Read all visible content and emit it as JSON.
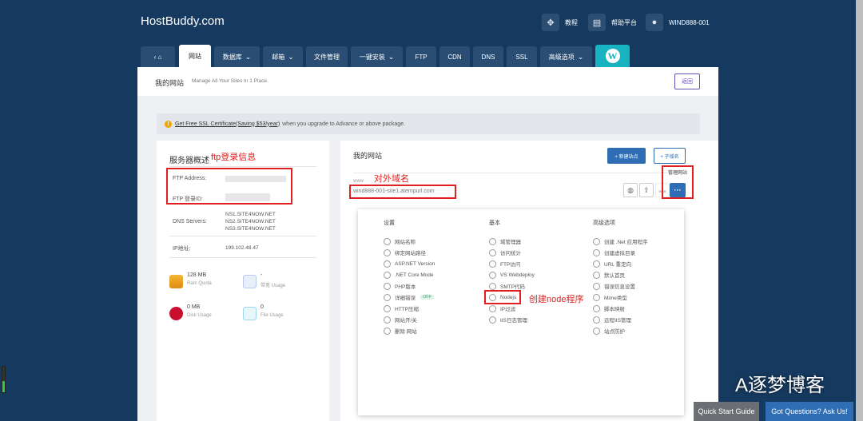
{
  "header": {
    "brand": "HostBuddy.com",
    "tutorial": "教程",
    "help": "帮助平台",
    "user": "WIND888-001"
  },
  "tabs": [
    {
      "label": "网站"
    },
    {
      "label": "数据库"
    },
    {
      "label": "邮箱"
    },
    {
      "label": "文件管理"
    },
    {
      "label": "一键安装"
    },
    {
      "label": "FTP"
    },
    {
      "label": "CDN"
    },
    {
      "label": "DNS"
    },
    {
      "label": "SSL"
    },
    {
      "label": "高级选项"
    }
  ],
  "page": {
    "title": "我的网站",
    "subtitle": "Manage All Your Sites In 1 Place.",
    "return": "返回"
  },
  "ssl_banner": {
    "link": "Get Free SSL Certificate(Saving $53/year)",
    "text": "when you upgrade to Advance or above package."
  },
  "server": {
    "title": "服务器概述",
    "ftp_address_label": "FTP Address:",
    "ftp_login_label": "FTP 登录ID:",
    "dns_label": "DNS Servers:",
    "dns": [
      "NS1.SITE4NOW.NET",
      "NS2.SITE4NOW.NET",
      "NS3.SITE4NOW.NET"
    ],
    "ip_label": "IP地址:",
    "ip": "199.102.48.47",
    "ram_value": "128 MB",
    "ram_label": "Ram Quota",
    "bw_value": "-",
    "bw_label": "带宽 Usage",
    "disk_value": "0 MB",
    "disk_label": "Disk Usage",
    "file_value": "0",
    "file_label": "File Usage"
  },
  "sites": {
    "title": "我的网站",
    "new_site": "+ 新建站点",
    "sub_domain": "+ 子域名",
    "manage": "管理网站",
    "www": "www",
    "domain": "wind888-001-site1.atempurl.com",
    "more": "···"
  },
  "menu": {
    "col1_head": "设置",
    "col1": [
      "网站名称",
      "绑定网站路径",
      "ASP.NET Version",
      ".NET Core Mode",
      "PHP版本",
      "详细错误",
      "HTTP压缩",
      "网站开/关",
      "删除 网站"
    ],
    "off": "OFF",
    "col2_head": "基本",
    "col2": [
      "域管理器",
      "访问统计",
      "FTP访问",
      "VS Webdeploy",
      "SMTP代码",
      "Nodejs",
      "IP过滤",
      "IIS日志管理"
    ],
    "col3_head": "高级选项",
    "col3": [
      "创建 .Net 应用程序",
      "创建虚拟目录",
      "URL 重定向",
      "默认首页",
      "错误信息设置",
      "Mime类型",
      "脚本映射",
      "远程IIS管理",
      "站点防护"
    ]
  },
  "annotations": {
    "ftp": "ftp登录信息",
    "domain": "对外域名",
    "node": "创建node程序"
  },
  "footer": {
    "watermark": "A逐梦博客",
    "quick_start": "Quick Start Guide",
    "ask": "Got Questions? Ask Us!"
  },
  "progress_level": 0.45
}
